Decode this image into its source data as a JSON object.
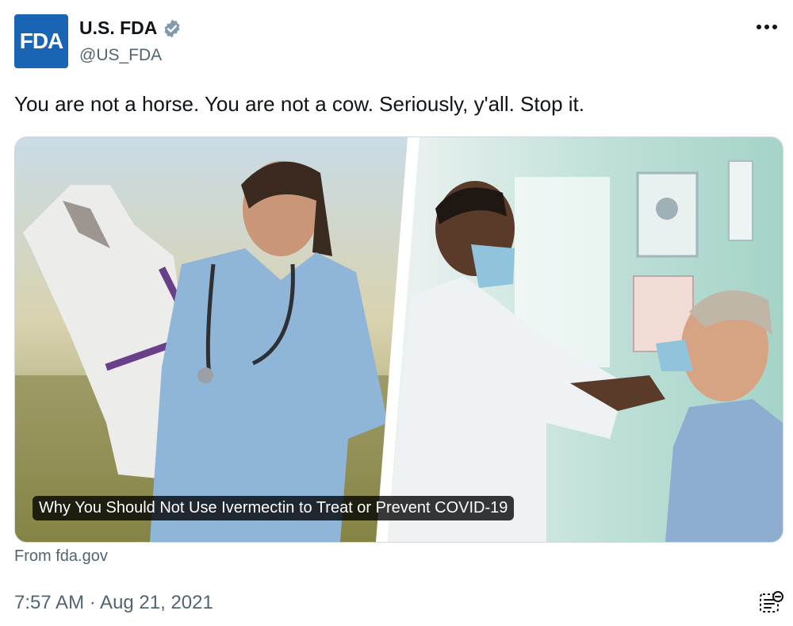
{
  "account": {
    "avatar_text": "FDA",
    "display_name": "U.S. FDA",
    "handle": "@US_FDA",
    "verified_icon": "verified-badge-icon"
  },
  "tweet": {
    "text": "You are not a horse. You are not a cow. Seriously, y'all. Stop it.",
    "media_caption": "Why You Should Not Use Ivermectin to Treat or Prevent COVID-19",
    "source": "From fda.gov",
    "timestamp": "7:57 AM · Aug 21, 2021"
  },
  "icons": {
    "more": "more-options-icon",
    "note": "community-note-icon"
  },
  "colors": {
    "avatar_bg": "#1a64b4",
    "verified": "#829aab",
    "secondary_text": "#536471",
    "border": "#cfd9de"
  }
}
